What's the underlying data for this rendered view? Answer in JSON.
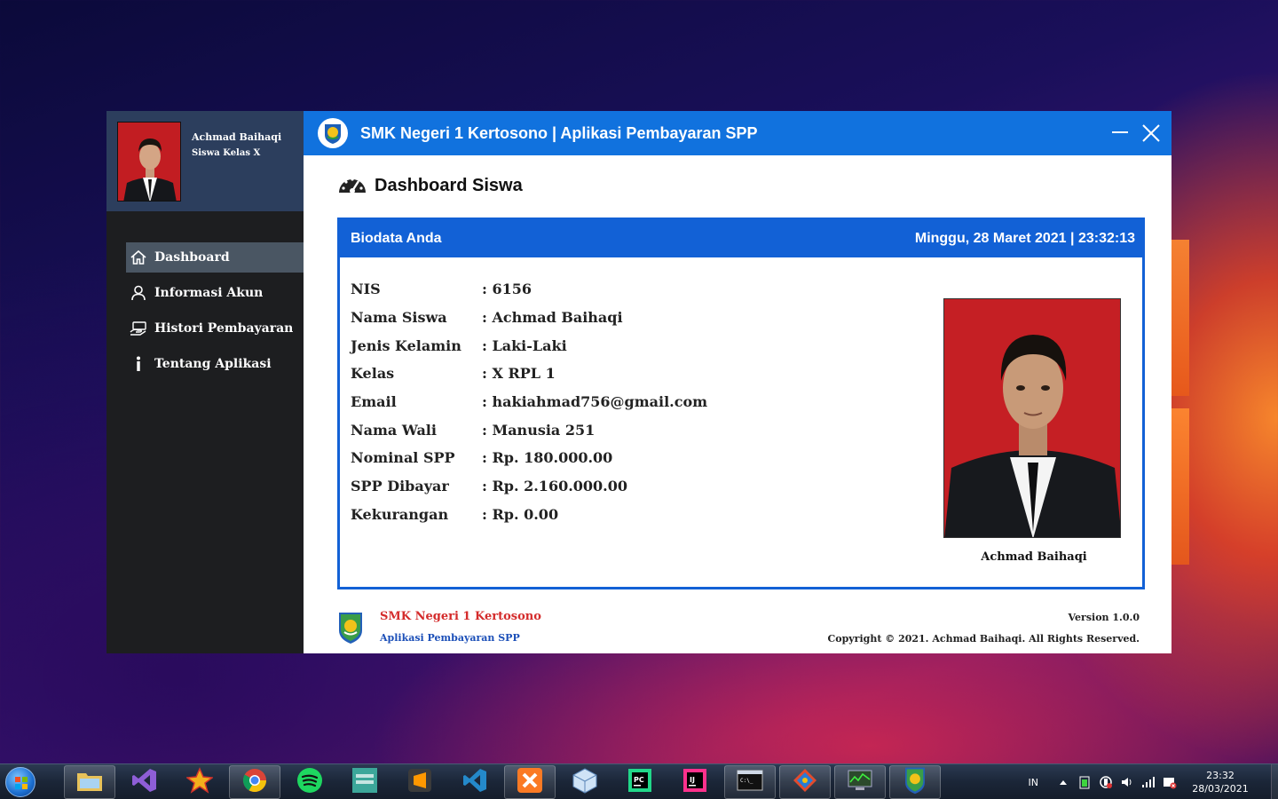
{
  "sidebar": {
    "profile_name": "Achmad Baihaqi",
    "profile_role": "Siswa Kelas X",
    "items": [
      {
        "label": "Dashboard",
        "icon": "home-icon",
        "active": true
      },
      {
        "label": "Informasi Akun",
        "icon": "user-icon",
        "active": false
      },
      {
        "label": "Histori Pembayaran",
        "icon": "payment-hand-icon",
        "active": false
      },
      {
        "label": "Tentang Aplikasi",
        "icon": "info-icon",
        "active": false
      }
    ]
  },
  "titlebar": {
    "title": "SMK Negeri 1 Kertosono | Aplikasi Pembayaran SPP",
    "color": "#1172de"
  },
  "page": {
    "title": "Dashboard Siswa",
    "icon": "speedometer-icon"
  },
  "biodata": {
    "header": "Biodata Anda",
    "datetime": "Minggu, 28 Maret 2021 | 23:32:13",
    "rows": [
      {
        "label": "NIS",
        "value": ": 6156"
      },
      {
        "label": "Nama Siswa",
        "value": ": Achmad Baihaqi"
      },
      {
        "label": "Jenis Kelamin",
        "value": ": Laki-Laki"
      },
      {
        "label": "Kelas",
        "value": ": X RPL 1"
      },
      {
        "label": "Email",
        "value": ": hakiahmad756@gmail.com"
      },
      {
        "label": "Nama Wali",
        "value": ": Manusia 251"
      },
      {
        "label": "Nominal SPP",
        "value": ": Rp. 180.000.00"
      },
      {
        "label": "SPP Dibayar",
        "value": ": Rp. 2.160.000.00"
      },
      {
        "label": "Kekurangan",
        "value": ": Rp. 0.00"
      }
    ],
    "photo_caption": "Achmad Baihaqi",
    "accent": "#1261d6"
  },
  "footer": {
    "school": "SMK Negeri 1 Kertosono",
    "app": "Aplikasi Pembayaran SPP",
    "version": "Version 1.0.0",
    "copyright": "Copyright © 2021. Achmad Baihaqi. All Rights Reserved."
  },
  "taskbar": {
    "apps": [
      "file-explorer-icon",
      "visual-studio-icon",
      "star-app-icon",
      "chrome-icon",
      "spotify-icon",
      "android-studio-icon",
      "sublime-text-icon",
      "vscode-icon",
      "xampp-icon",
      "virtualbox-icon",
      "pycharm-icon",
      "intellij-icon",
      "terminal-icon",
      "git-icon",
      "task-manager-icon",
      "spp-app-icon"
    ],
    "language": "IN",
    "time": "23:32",
    "date": "28/03/2021"
  }
}
